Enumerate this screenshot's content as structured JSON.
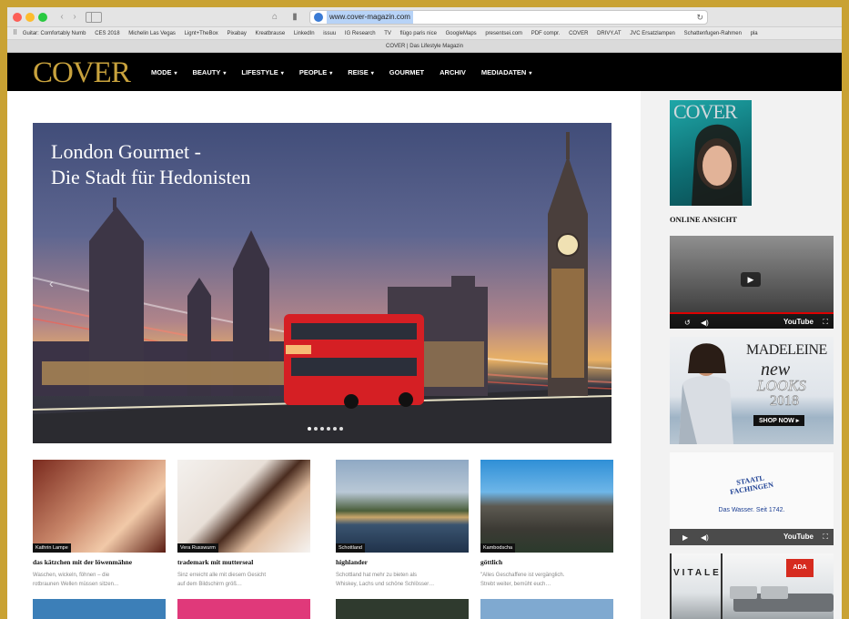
{
  "browser": {
    "url": "www.cover-magazin.com",
    "tab_title": "COVER | Das Lifestyle Magazin",
    "bookmarks": [
      "Guitar: Comfortably Numb",
      "CES 2018",
      "Michelin Las Vegas",
      "Lignt+TheBox",
      "Pixabay",
      "Kreatbrause",
      "LinkedIn",
      "issuu",
      "IG Research",
      "TV",
      "flügo paris nice",
      "GoogleMaps",
      "presentsei.com",
      "PDF compr.",
      "COVER",
      "DRIVY.AT",
      "JVC Ersatzlampen",
      "Schattenfugen-Rahmen",
      "pla"
    ]
  },
  "site": {
    "logo": "COVER",
    "menu": [
      "MODE",
      "BEAUTY",
      "LIFESTYLE",
      "PEOPLE",
      "REISE",
      "GOURMET",
      "ARCHIV",
      "MEDIADATEN"
    ],
    "menu_caret": [
      true,
      true,
      true,
      true,
      true,
      false,
      false,
      true
    ]
  },
  "hero": {
    "title_line1": "London Gourmet -",
    "title_line2": "Die Stadt für Hedonisten",
    "slide_count": 6,
    "active_slide": 1
  },
  "articles": [
    {
      "tag": "Kathrin Lampe",
      "title": "das kätzchen mit der löwenmähne",
      "excerpt1": "Waschen, wickeln, föhnen – die",
      "excerpt2": "rotbraunen Wellen müssen sitzen…"
    },
    {
      "tag": "Vera Russwurm",
      "title": "trademark mit mutterseal",
      "excerpt1": "Sinz erreicht alle mit diesem Gesicht",
      "excerpt2": "auf dem Bildschirm größ…"
    },
    {
      "tag": "Schottland",
      "title": "highlander",
      "excerpt1": "Schottland hat mehr zu bieten als",
      "excerpt2": "Whiskey, Lachs und schöne Schlösser…"
    },
    {
      "tag": "Kambodscha",
      "title": "göttlich",
      "excerpt1": "\"Alles Geschaffene ist vergänglich.",
      "excerpt2": "Strebt weiter, bemüht euch…"
    }
  ],
  "sidebar": {
    "magazine_logo": "COVER",
    "online_label": "ONLINE ANSICHT",
    "video_brand": "YouTube",
    "ad_madeleine": {
      "brand": "MADELEINE",
      "new": "new",
      "looks": "LOOKS",
      "year": "2018",
      "cta": "SHOP NOW ▸"
    },
    "ad_staatl": {
      "brand": "STAATL FACHINGEN",
      "slogan": "Das Wasser. Seit 1742."
    },
    "ad_vitale": {
      "brand": "VITALE",
      "badge": "ADA"
    }
  },
  "colors": {
    "accent_gold": "#c8a23d",
    "frame": "#c9a233",
    "header_bg": "#000000"
  }
}
